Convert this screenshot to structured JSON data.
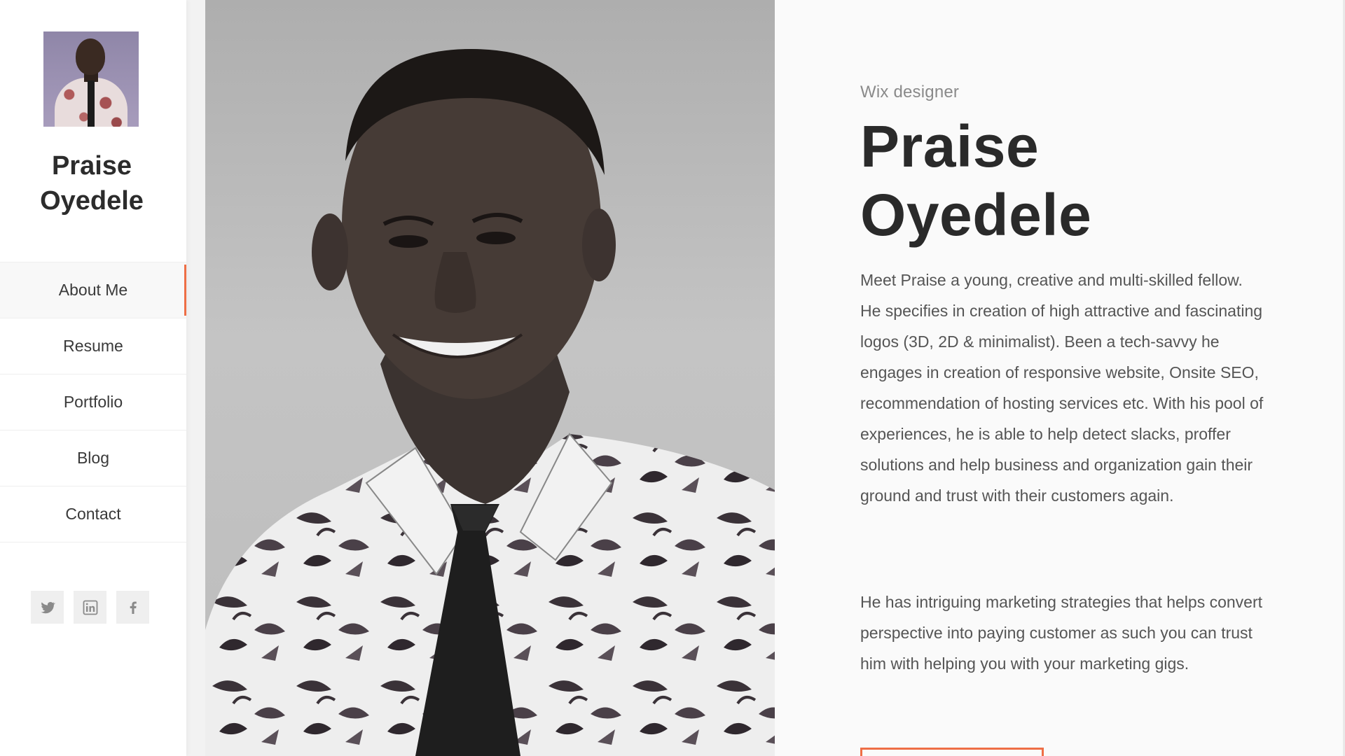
{
  "sidebar": {
    "name": "Praise Oyedele",
    "nav": [
      {
        "label": "About Me",
        "active": true
      },
      {
        "label": "Resume"
      },
      {
        "label": "Portfolio"
      },
      {
        "label": "Blog"
      },
      {
        "label": "Contact"
      }
    ],
    "social": [
      {
        "icon": "twitter-icon"
      },
      {
        "icon": "linkedin-icon"
      },
      {
        "icon": "facebook-icon"
      }
    ]
  },
  "main": {
    "subtitle": "Wix designer",
    "title_line1": "Praise",
    "title_line2": "Oyedele",
    "paragraph1": "Meet Praise a young, creative and multi-skilled fellow. He specifies in creation of high attractive and fascinating logos (3D, 2D & minimalist). Been a tech-savvy he engages in creation of responsive website, Onsite SEO, recommendation of hosting services etc. With his pool of experiences, he is able to help detect slacks, proffer solutions and help business and organization gain their ground and trust with their customers again.",
    "paragraph2": "He has intriguing marketing strategies that helps convert perspective into paying customer as such you can trust him with helping you with your marketing gigs."
  },
  "colors": {
    "accent": "#ee6e46",
    "text_dark": "#2a2a2a",
    "text_body": "#555555",
    "sidebar_bg": "#ffffff",
    "content_bg": "#fafafa"
  }
}
